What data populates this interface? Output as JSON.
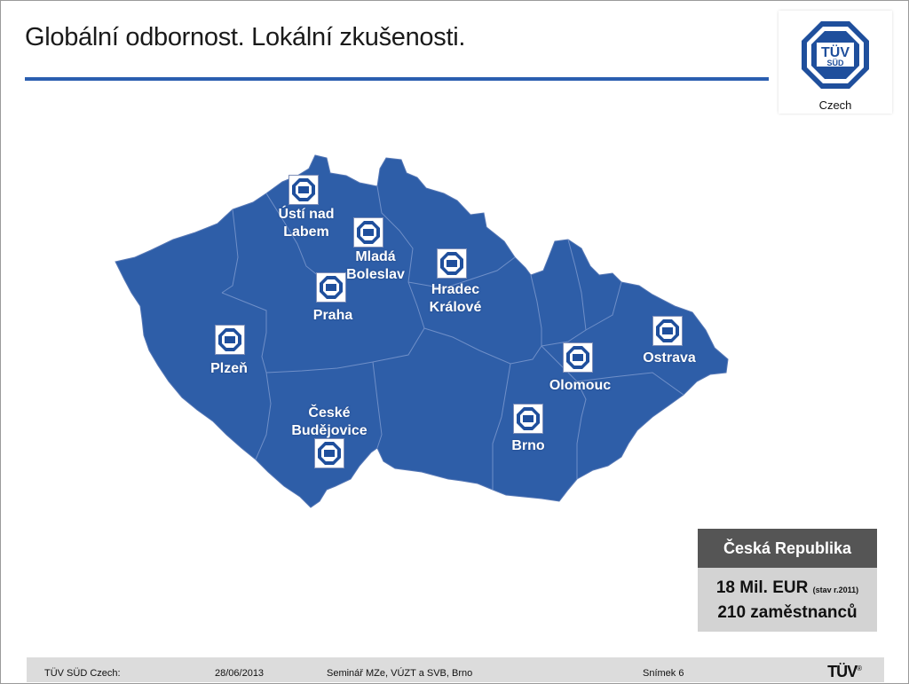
{
  "slide": {
    "title": "Globální odbornost. Lokální zkušenosti."
  },
  "logo": {
    "brand_line1": "TÜV",
    "brand_line2": "SÜD",
    "caption": "Czech"
  },
  "map": {
    "fill_color": "#2e5ea8",
    "border_color": "#6f8fc8",
    "cities": [
      {
        "label_line1": "Ústí nad",
        "label_line2": "Labem"
      },
      {
        "label_line1": "Mladá",
        "label_line2": "Boleslav"
      },
      {
        "label_line1": "Hradec",
        "label_line2": "Králové"
      },
      {
        "label_line1": "Praha",
        "label_line2": ""
      },
      {
        "label_line1": "Plzeň",
        "label_line2": ""
      },
      {
        "label_line1": "České",
        "label_line2": "Budějovice"
      },
      {
        "label_line1": "Olomouc",
        "label_line2": ""
      },
      {
        "label_line1": "Ostrava",
        "label_line2": ""
      },
      {
        "label_line1": "Brno",
        "label_line2": ""
      }
    ]
  },
  "info": {
    "heading": "Česká Republika",
    "revenue": "18  Mil. EUR",
    "revenue_note": "(stav r.2011)",
    "employees": "210 zaměstnanců"
  },
  "footer": {
    "company": "TÜV SÜD Czech:",
    "date": "28/06/2013",
    "event": "Seminář  MZe, VÚZT a SVB, Brno",
    "slide_number": "Snímek 6",
    "logo_text": "TÜV",
    "logo_mark": "®"
  }
}
